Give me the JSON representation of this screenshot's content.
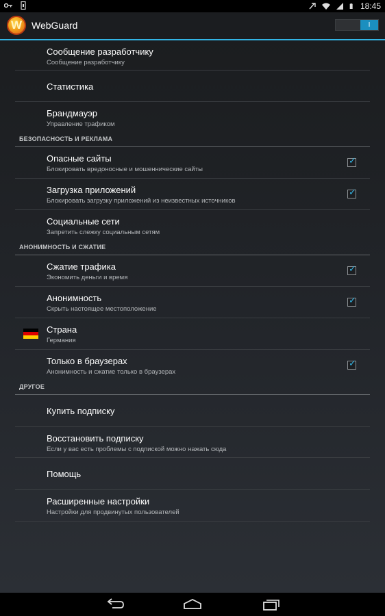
{
  "status_bar": {
    "left_icons": [
      "key-icon",
      "debug-icon"
    ],
    "right_icons": [
      "vpn-icon",
      "wifi-icon",
      "signal-icon",
      "battery-icon"
    ],
    "time": "18:45"
  },
  "action_bar": {
    "logo_letter": "W",
    "title": "WebGuard",
    "toggle_label": "I",
    "toggle_on": true
  },
  "items": {
    "dev_message": {
      "title": "Сообщение разработчику",
      "subtitle": "Сообщение разработчику"
    },
    "stats": {
      "title": "Статистика"
    },
    "firewall": {
      "title": "Брандмауэр",
      "subtitle": "Управление трафиком"
    },
    "dangerous": {
      "title": "Опасные сайты",
      "subtitle": "Блокировать вредоносные и мошеннические сайты",
      "checked": true
    },
    "app_download": {
      "title": "Загрузка приложений",
      "subtitle": "Блокировать загрузку приложений из неизвестных источников",
      "checked": true
    },
    "social": {
      "title": "Социальные сети",
      "subtitle": "Запретить слежку социальным сетям"
    },
    "compress": {
      "title": "Сжатие трафика",
      "subtitle": "Экономить деньги и время",
      "checked": true
    },
    "anon": {
      "title": "Анонимность",
      "subtitle": "Скрыть настоящее местоположение",
      "checked": true
    },
    "country": {
      "title": "Страна",
      "subtitle": "Германия",
      "flag_colors": [
        "#000000",
        "#dd0000",
        "#ffce00"
      ]
    },
    "browsers": {
      "title": "Только в браузерах",
      "subtitle": "Анонимность и сжатие только в браузерах",
      "checked": true
    },
    "buy": {
      "title": "Купить подписку"
    },
    "restore": {
      "title": "Восстановить подписку",
      "subtitle": "Если у вас есть проблемы с подпиской можно нажать сюда"
    },
    "help": {
      "title": "Помощь"
    },
    "advanced": {
      "title": "Расширенные настройки",
      "subtitle": "Настройки для продвинутых пользователей"
    }
  },
  "sections": {
    "security": "БЕЗОПАСНОСТЬ И РЕКЛАМА",
    "anonymity": "АНОНИМНОСТЬ И СЖАТИЕ",
    "other": "ДРУГОЕ"
  },
  "nav_bar": {
    "buttons": [
      "back-icon",
      "home-icon",
      "recent-apps-icon"
    ]
  },
  "colors": {
    "accent": "#33b5e5",
    "background": "#1f2226"
  }
}
